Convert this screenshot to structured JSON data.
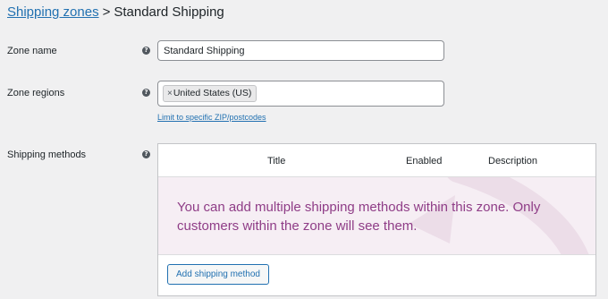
{
  "breadcrumb": {
    "parent_link": "Shipping zones",
    "separator": ">",
    "current": "Standard Shipping"
  },
  "help_icon_glyph": "?",
  "zone_name": {
    "label": "Zone name",
    "value": "Standard Shipping"
  },
  "zone_regions": {
    "label": "Zone regions",
    "selected": [
      {
        "remove_glyph": "×",
        "label": "United States (US)"
      }
    ],
    "limit_link": "Limit to specific ZIP/postcodes"
  },
  "shipping_methods": {
    "label": "Shipping methods",
    "columns": [
      "Title",
      "Enabled",
      "Description"
    ],
    "blank_state_message": "You can add multiple shipping methods within this zone. Only customers within the zone will see them.",
    "add_button": "Add shipping method"
  },
  "colors": {
    "link": "#2271b1",
    "blank_state_bg": "#f6eef4",
    "blank_state_text": "#8f3d87",
    "page_bg": "#f0f0f1"
  },
  "icons": {
    "help": "question-circle-icon",
    "remove": "remove-x-icon",
    "background": "truck-swoosh-icon"
  }
}
